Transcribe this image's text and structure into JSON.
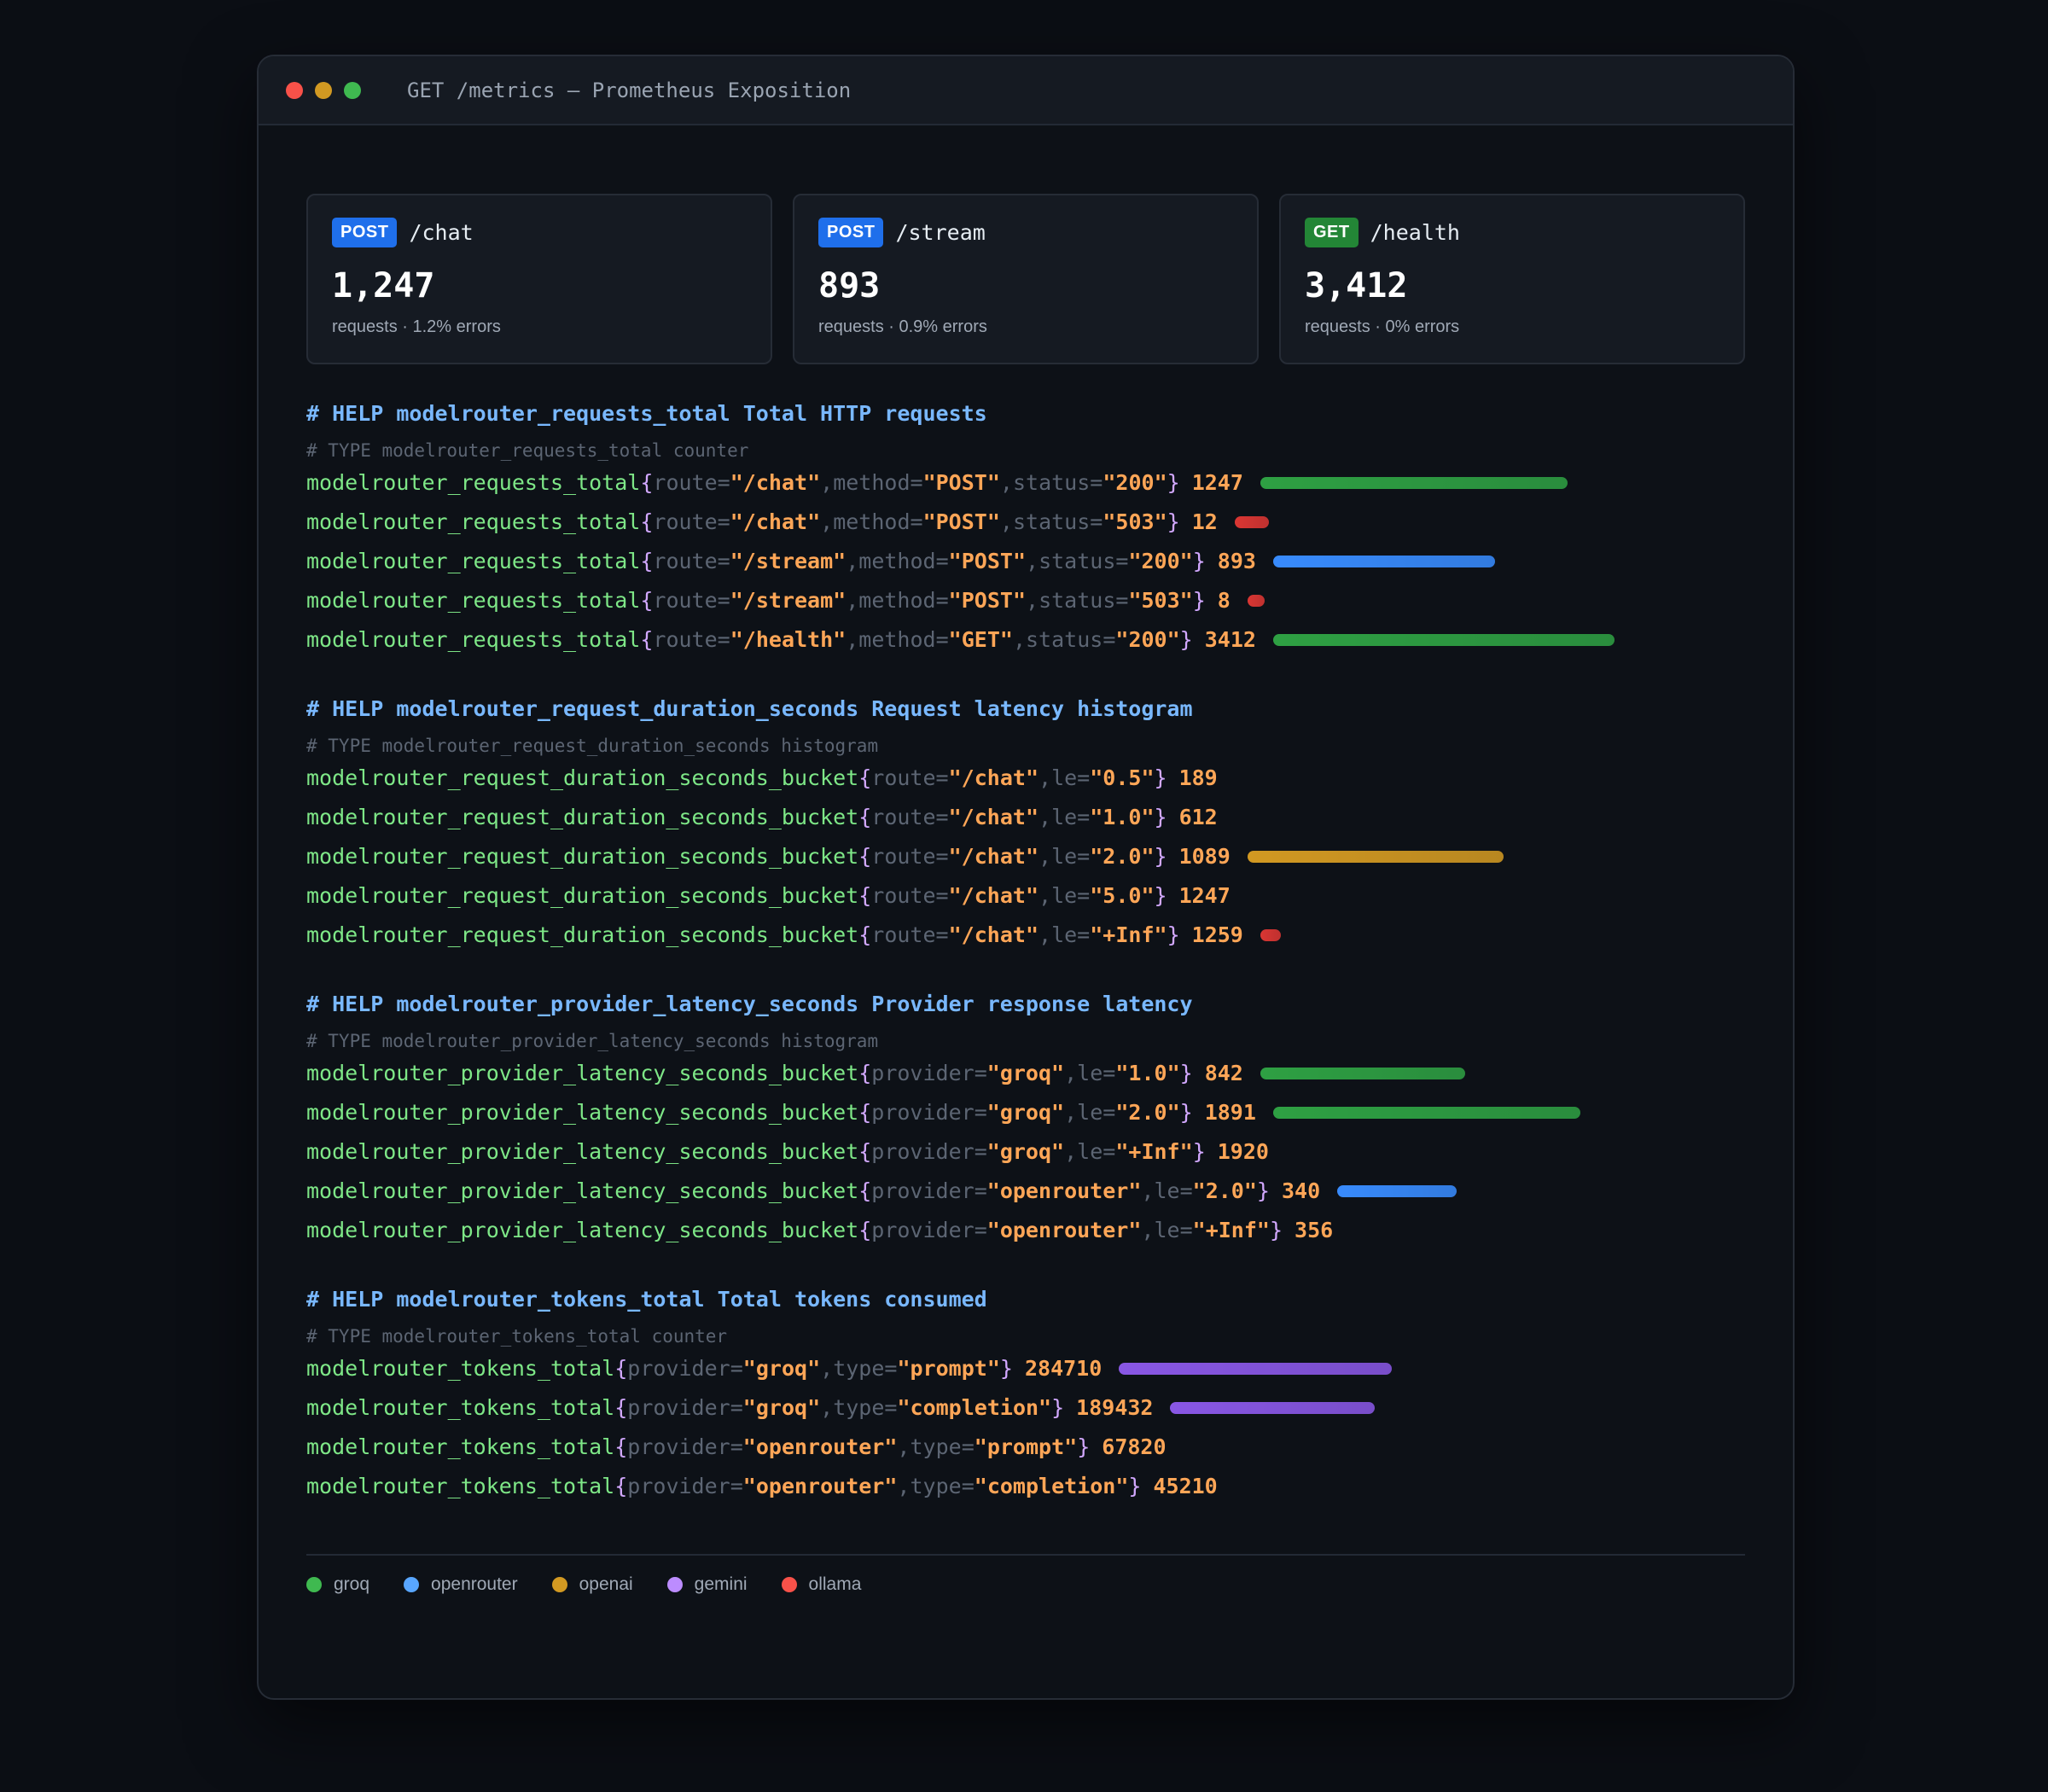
{
  "window": {
    "title": "GET /metrics — Prometheus Exposition"
  },
  "cards": [
    {
      "method": "POST",
      "route": "/chat",
      "value": "1,247",
      "sub": "requests · 1.2% errors",
      "method_color": "#1f6feb"
    },
    {
      "method": "POST",
      "route": "/stream",
      "value": "893",
      "sub": "requests · 0.9% errors",
      "method_color": "#1f6feb"
    },
    {
      "method": "GET",
      "route": "/health",
      "value": "3,412",
      "sub": "requests · 0% errors",
      "method_color": "#238636"
    }
  ],
  "sections": [
    {
      "help": "# HELP modelrouter_requests_total Total HTTP requests",
      "type": "# TYPE modelrouter_requests_total counter",
      "lines": [
        {
          "name": "modelrouter_requests_total",
          "labels": [
            [
              "route",
              "/chat"
            ],
            [
              "method",
              "POST"
            ],
            [
              "status",
              "200"
            ]
          ],
          "value": "1247",
          "bar": "green",
          "bar_fraction": 0.9
        },
        {
          "name": "modelrouter_requests_total",
          "labels": [
            [
              "route",
              "/chat"
            ],
            [
              "method",
              "POST"
            ],
            [
              "status",
              "503"
            ]
          ],
          "value": "12",
          "bar": "red",
          "bar_fraction": 0.1
        },
        {
          "name": "modelrouter_requests_total",
          "labels": [
            [
              "route",
              "/stream"
            ],
            [
              "method",
              "POST"
            ],
            [
              "status",
              "200"
            ]
          ],
          "value": "893",
          "bar": "blue",
          "bar_fraction": 0.65
        },
        {
          "name": "modelrouter_requests_total",
          "labels": [
            [
              "route",
              "/stream"
            ],
            [
              "method",
              "POST"
            ],
            [
              "status",
              "503"
            ]
          ],
          "value": "8",
          "bar": "red",
          "bar_fraction": 0.05
        },
        {
          "name": "modelrouter_requests_total",
          "labels": [
            [
              "route",
              "/health"
            ],
            [
              "method",
              "GET"
            ],
            [
              "status",
              "200"
            ]
          ],
          "value": "3412",
          "bar": "green",
          "bar_fraction": 1.0
        }
      ]
    },
    {
      "help": "# HELP modelrouter_request_duration_seconds Request latency histogram",
      "type": "# TYPE modelrouter_request_duration_seconds histogram",
      "lines": [
        {
          "name": "modelrouter_request_duration_seconds_bucket",
          "labels": [
            [
              "route",
              "/chat"
            ],
            [
              "le",
              "0.5"
            ]
          ],
          "value": "189",
          "bar": "",
          "bar_fraction": 0
        },
        {
          "name": "modelrouter_request_duration_seconds_bucket",
          "labels": [
            [
              "route",
              "/chat"
            ],
            [
              "le",
              "1.0"
            ]
          ],
          "value": "612",
          "bar": "",
          "bar_fraction": 0
        },
        {
          "name": "modelrouter_request_duration_seconds_bucket",
          "labels": [
            [
              "route",
              "/chat"
            ],
            [
              "le",
              "2.0"
            ]
          ],
          "value": "1089",
          "bar": "yellow",
          "bar_fraction": 0.75
        },
        {
          "name": "modelrouter_request_duration_seconds_bucket",
          "labels": [
            [
              "route",
              "/chat"
            ],
            [
              "le",
              "5.0"
            ]
          ],
          "value": "1247",
          "bar": "",
          "bar_fraction": 0
        },
        {
          "name": "modelrouter_request_duration_seconds_bucket",
          "labels": [
            [
              "route",
              "/chat"
            ],
            [
              "le",
              "+Inf"
            ]
          ],
          "value": "1259",
          "bar": "red",
          "bar_fraction": 0.06
        }
      ]
    },
    {
      "help": "# HELP modelrouter_provider_latency_seconds Provider response latency",
      "type": "# TYPE modelrouter_provider_latency_seconds histogram",
      "lines": [
        {
          "name": "modelrouter_provider_latency_seconds_bucket",
          "labels": [
            [
              "provider",
              "groq"
            ],
            [
              "le",
              "1.0"
            ]
          ],
          "value": "842",
          "bar": "green",
          "bar_fraction": 0.6
        },
        {
          "name": "modelrouter_provider_latency_seconds_bucket",
          "labels": [
            [
              "provider",
              "groq"
            ],
            [
              "le",
              "2.0"
            ]
          ],
          "value": "1891",
          "bar": "green",
          "bar_fraction": 0.9
        },
        {
          "name": "modelrouter_provider_latency_seconds_bucket",
          "labels": [
            [
              "provider",
              "groq"
            ],
            [
              "le",
              "+Inf"
            ]
          ],
          "value": "1920",
          "bar": "",
          "bar_fraction": 0
        },
        {
          "name": "modelrouter_provider_latency_seconds_bucket",
          "labels": [
            [
              "provider",
              "openrouter"
            ],
            [
              "le",
              "2.0"
            ]
          ],
          "value": "340",
          "bar": "blue",
          "bar_fraction": 0.35
        },
        {
          "name": "modelrouter_provider_latency_seconds_bucket",
          "labels": [
            [
              "provider",
              "openrouter"
            ],
            [
              "le",
              "+Inf"
            ]
          ],
          "value": "356",
          "bar": "",
          "bar_fraction": 0
        }
      ]
    },
    {
      "help": "# HELP modelrouter_tokens_total Total tokens consumed",
      "type": "# TYPE modelrouter_tokens_total counter",
      "lines": [
        {
          "name": "modelrouter_tokens_total",
          "labels": [
            [
              "provider",
              "groq"
            ],
            [
              "type",
              "prompt"
            ]
          ],
          "value": "284710",
          "bar": "purple",
          "bar_fraction": 0.8
        },
        {
          "name": "modelrouter_tokens_total",
          "labels": [
            [
              "provider",
              "groq"
            ],
            [
              "type",
              "completion"
            ]
          ],
          "value": "189432",
          "bar": "purple",
          "bar_fraction": 0.6
        },
        {
          "name": "modelrouter_tokens_total",
          "labels": [
            [
              "provider",
              "openrouter"
            ],
            [
              "type",
              "prompt"
            ]
          ],
          "value": "67820",
          "bar": "",
          "bar_fraction": 0
        },
        {
          "name": "modelrouter_tokens_total",
          "labels": [
            [
              "provider",
              "openrouter"
            ],
            [
              "type",
              "completion"
            ]
          ],
          "value": "45210",
          "bar": "",
          "bar_fraction": 0
        }
      ]
    }
  ],
  "legend": [
    {
      "label": "groq",
      "color": "#3fb950"
    },
    {
      "label": "openrouter",
      "color": "#58a6ff"
    },
    {
      "label": "openai",
      "color": "#d29922"
    },
    {
      "label": "gemini",
      "color": "#bc8cff"
    },
    {
      "label": "ollama",
      "color": "#f85149"
    }
  ],
  "colors": {
    "green": "#2ea043",
    "red": "#da3633",
    "blue": "#388bfd",
    "yellow": "#d29922",
    "purple": "#8957e5"
  }
}
